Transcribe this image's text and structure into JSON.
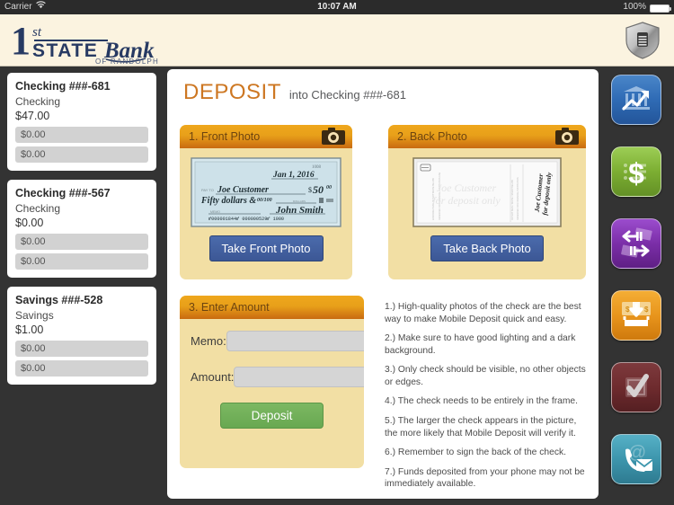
{
  "statusbar": {
    "carrier": "Carrier",
    "wifi_icon": "wifi-icon",
    "time": "10:07 AM",
    "battery_pct": "100%",
    "battery_icon": "battery-full-icon"
  },
  "brand": {
    "logo_line1": "1",
    "logo_sup": "st",
    "logo_line2": "STATE",
    "logo_script": "Bank",
    "logo_tagline": "OF RANDOLPH",
    "secure_icon": "shield-lock-icon",
    "bg": "#fbf3e0",
    "ink": "#273a63"
  },
  "sidebar": {
    "accounts": [
      {
        "name": "Checking ###-681",
        "type": "Checking",
        "balance": "$47.00",
        "row1": "$0.00",
        "row2": "$0.00"
      },
      {
        "name": "Checking ###-567",
        "type": "Checking",
        "balance": "$0.00",
        "row1": "$0.00",
        "row2": "$0.00"
      },
      {
        "name": "Savings ###-528",
        "type": "Savings",
        "balance": "$1.00",
        "row1": "$0.00",
        "row2": "$0.00"
      }
    ]
  },
  "main": {
    "title": "DEPOSIT",
    "subtitle": "into Checking ###-681",
    "title_color": "#cd7722",
    "front_panel": {
      "header": "1. Front Photo",
      "camera_icon": "camera-icon",
      "button": "Take Front Photo"
    },
    "back_panel": {
      "header": "2. Back Photo",
      "camera_icon": "camera-icon",
      "button": "Take Back Photo"
    },
    "amount_panel": {
      "header": "3. Enter Amount",
      "memo_label": "Memo:",
      "memo_value": "",
      "memo_placeholder": "",
      "amount_label": "Amount:",
      "amount_value": "",
      "amount_placeholder": "",
      "deposit_button": "Deposit"
    },
    "check_front": {
      "date": "Jan 1, 2016",
      "payee": "Joe Customer",
      "amount_numeric": "50",
      "amount_cents": "00",
      "amount_words": "Fifty dollars &",
      "amount_words_cents": "00/100",
      "signature": "John Smith",
      "micr": "⑈000001844⑈  000000529⑈  1000"
    },
    "check_back": {
      "endorsement": "Joe Customer for deposit only"
    },
    "tips": [
      "1.) High-quality photos of the check are the best way to make Mobile Deposit quick and easy.",
      "2.) Make sure to have good lighting and a dark background.",
      "3.) Only check should be visible, no other objects or edges.",
      "4.) The check needs to be entirely in the frame.",
      "5.) The larger the check appears in the picture, the more likely that Mobile Deposit will verify it.",
      "6.) Remember to sign the back of the check.",
      "7.) Funds deposited from your phone may not be immediately available."
    ]
  },
  "rail": {
    "items": [
      {
        "name": "accounts-overview",
        "icon": "bank-chart-icon",
        "color": "#2f6bb5"
      },
      {
        "name": "balances",
        "icon": "dollar-sign-icon",
        "color": "#7cae32"
      },
      {
        "name": "transfers",
        "icon": "transfer-arrows-icon",
        "color": "#7b2ea8"
      },
      {
        "name": "deposit",
        "icon": "deposit-money-icon",
        "color": "#e8951c"
      },
      {
        "name": "check-register",
        "icon": "check-mark-icon",
        "color": "#6e2b2e"
      },
      {
        "name": "contact",
        "icon": "phone-mail-icon",
        "color": "#3d96ad"
      }
    ]
  }
}
